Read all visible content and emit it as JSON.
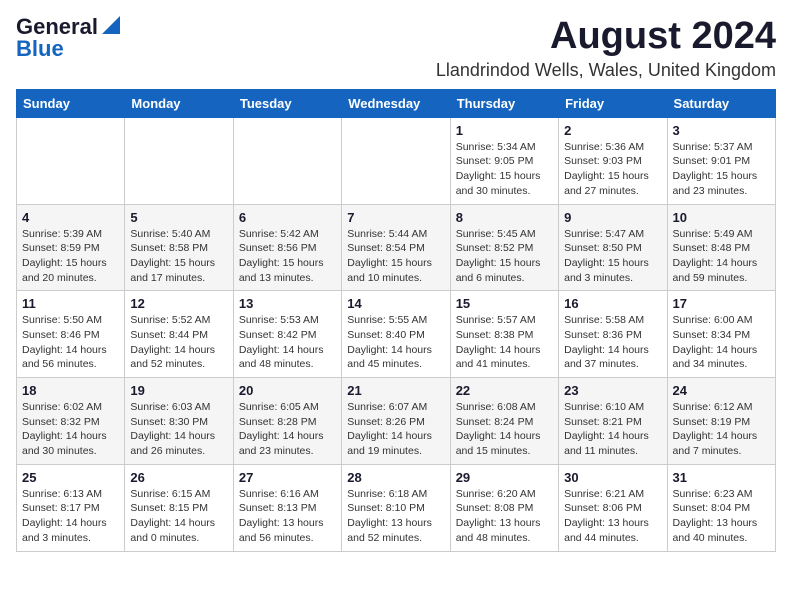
{
  "logo": {
    "general": "General",
    "blue": "Blue",
    "url_text": "GeneralBlue"
  },
  "title": "August 2024",
  "subtitle": "Llandrindod Wells, Wales, United Kingdom",
  "headers": [
    "Sunday",
    "Monday",
    "Tuesday",
    "Wednesday",
    "Thursday",
    "Friday",
    "Saturday"
  ],
  "weeks": [
    [
      {
        "day": "",
        "info": ""
      },
      {
        "day": "",
        "info": ""
      },
      {
        "day": "",
        "info": ""
      },
      {
        "day": "",
        "info": ""
      },
      {
        "day": "1",
        "info": "Sunrise: 5:34 AM\nSunset: 9:05 PM\nDaylight: 15 hours\nand 30 minutes."
      },
      {
        "day": "2",
        "info": "Sunrise: 5:36 AM\nSunset: 9:03 PM\nDaylight: 15 hours\nand 27 minutes."
      },
      {
        "day": "3",
        "info": "Sunrise: 5:37 AM\nSunset: 9:01 PM\nDaylight: 15 hours\nand 23 minutes."
      }
    ],
    [
      {
        "day": "4",
        "info": "Sunrise: 5:39 AM\nSunset: 8:59 PM\nDaylight: 15 hours\nand 20 minutes."
      },
      {
        "day": "5",
        "info": "Sunrise: 5:40 AM\nSunset: 8:58 PM\nDaylight: 15 hours\nand 17 minutes."
      },
      {
        "day": "6",
        "info": "Sunrise: 5:42 AM\nSunset: 8:56 PM\nDaylight: 15 hours\nand 13 minutes."
      },
      {
        "day": "7",
        "info": "Sunrise: 5:44 AM\nSunset: 8:54 PM\nDaylight: 15 hours\nand 10 minutes."
      },
      {
        "day": "8",
        "info": "Sunrise: 5:45 AM\nSunset: 8:52 PM\nDaylight: 15 hours\nand 6 minutes."
      },
      {
        "day": "9",
        "info": "Sunrise: 5:47 AM\nSunset: 8:50 PM\nDaylight: 15 hours\nand 3 minutes."
      },
      {
        "day": "10",
        "info": "Sunrise: 5:49 AM\nSunset: 8:48 PM\nDaylight: 14 hours\nand 59 minutes."
      }
    ],
    [
      {
        "day": "11",
        "info": "Sunrise: 5:50 AM\nSunset: 8:46 PM\nDaylight: 14 hours\nand 56 minutes."
      },
      {
        "day": "12",
        "info": "Sunrise: 5:52 AM\nSunset: 8:44 PM\nDaylight: 14 hours\nand 52 minutes."
      },
      {
        "day": "13",
        "info": "Sunrise: 5:53 AM\nSunset: 8:42 PM\nDaylight: 14 hours\nand 48 minutes."
      },
      {
        "day": "14",
        "info": "Sunrise: 5:55 AM\nSunset: 8:40 PM\nDaylight: 14 hours\nand 45 minutes."
      },
      {
        "day": "15",
        "info": "Sunrise: 5:57 AM\nSunset: 8:38 PM\nDaylight: 14 hours\nand 41 minutes."
      },
      {
        "day": "16",
        "info": "Sunrise: 5:58 AM\nSunset: 8:36 PM\nDaylight: 14 hours\nand 37 minutes."
      },
      {
        "day": "17",
        "info": "Sunrise: 6:00 AM\nSunset: 8:34 PM\nDaylight: 14 hours\nand 34 minutes."
      }
    ],
    [
      {
        "day": "18",
        "info": "Sunrise: 6:02 AM\nSunset: 8:32 PM\nDaylight: 14 hours\nand 30 minutes."
      },
      {
        "day": "19",
        "info": "Sunrise: 6:03 AM\nSunset: 8:30 PM\nDaylight: 14 hours\nand 26 minutes."
      },
      {
        "day": "20",
        "info": "Sunrise: 6:05 AM\nSunset: 8:28 PM\nDaylight: 14 hours\nand 23 minutes."
      },
      {
        "day": "21",
        "info": "Sunrise: 6:07 AM\nSunset: 8:26 PM\nDaylight: 14 hours\nand 19 minutes."
      },
      {
        "day": "22",
        "info": "Sunrise: 6:08 AM\nSunset: 8:24 PM\nDaylight: 14 hours\nand 15 minutes."
      },
      {
        "day": "23",
        "info": "Sunrise: 6:10 AM\nSunset: 8:21 PM\nDaylight: 14 hours\nand 11 minutes."
      },
      {
        "day": "24",
        "info": "Sunrise: 6:12 AM\nSunset: 8:19 PM\nDaylight: 14 hours\nand 7 minutes."
      }
    ],
    [
      {
        "day": "25",
        "info": "Sunrise: 6:13 AM\nSunset: 8:17 PM\nDaylight: 14 hours\nand 3 minutes."
      },
      {
        "day": "26",
        "info": "Sunrise: 6:15 AM\nSunset: 8:15 PM\nDaylight: 14 hours\nand 0 minutes."
      },
      {
        "day": "27",
        "info": "Sunrise: 6:16 AM\nSunset: 8:13 PM\nDaylight: 13 hours\nand 56 minutes."
      },
      {
        "day": "28",
        "info": "Sunrise: 6:18 AM\nSunset: 8:10 PM\nDaylight: 13 hours\nand 52 minutes."
      },
      {
        "day": "29",
        "info": "Sunrise: 6:20 AM\nSunset: 8:08 PM\nDaylight: 13 hours\nand 48 minutes."
      },
      {
        "day": "30",
        "info": "Sunrise: 6:21 AM\nSunset: 8:06 PM\nDaylight: 13 hours\nand 44 minutes."
      },
      {
        "day": "31",
        "info": "Sunrise: 6:23 AM\nSunset: 8:04 PM\nDaylight: 13 hours\nand 40 minutes."
      }
    ]
  ]
}
